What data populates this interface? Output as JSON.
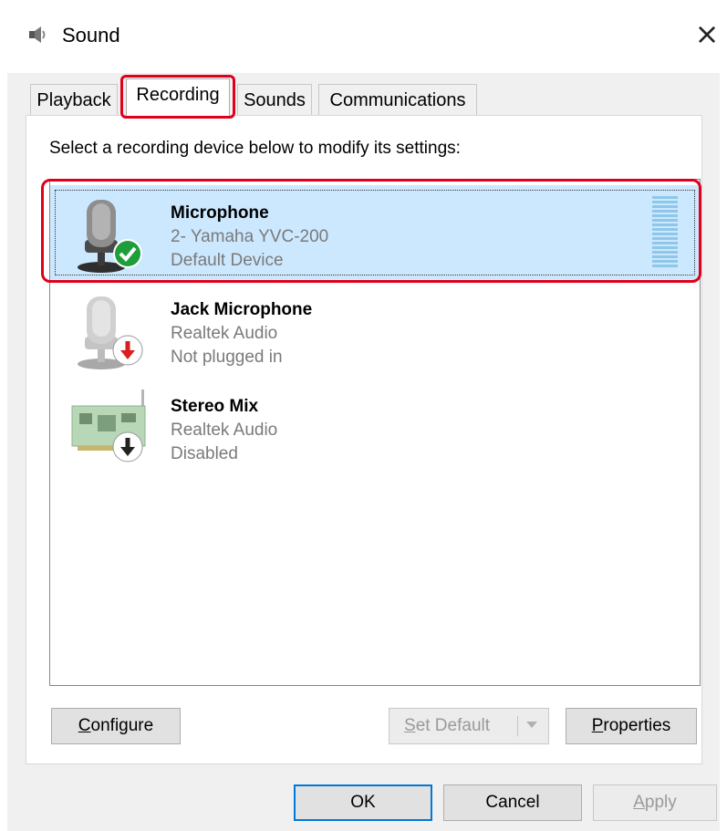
{
  "window": {
    "title": "Sound",
    "close_glyph": "×"
  },
  "tabs": [
    {
      "label": "Playback",
      "active": false
    },
    {
      "label": "Recording",
      "active": true
    },
    {
      "label": "Sounds",
      "active": false
    },
    {
      "label": "Communications",
      "active": false
    }
  ],
  "instruction": "Select a recording device below to modify its settings:",
  "devices": [
    {
      "name": "Microphone",
      "driver": "2- Yamaha YVC-200",
      "status": "Default Device",
      "icon": "microphone-icon",
      "badge": "default-check-icon",
      "selected": true
    },
    {
      "name": "Jack Microphone",
      "driver": "Realtek Audio",
      "status": "Not plugged in",
      "icon": "microphone-icon",
      "badge": "unplugged-arrow-icon",
      "selected": false
    },
    {
      "name": "Stereo Mix",
      "driver": "Realtek Audio",
      "status": "Disabled",
      "icon": "sound-card-icon",
      "badge": "disabled-arrow-icon",
      "selected": false
    }
  ],
  "buttons": {
    "configure": {
      "accel": "C",
      "rest": "onfigure"
    },
    "set_default": {
      "accel": "S",
      "rest": "et Default",
      "enabled": false
    },
    "properties": {
      "accel": "P",
      "rest": "roperties"
    },
    "ok": "OK",
    "cancel": "Cancel",
    "apply": {
      "accel": "A",
      "rest": "pply",
      "enabled": false
    }
  },
  "colors": {
    "selection": "#cce8ff",
    "annotation_highlight": "#e0001b",
    "default_badge": "#1e9e3a",
    "unplugged_badge": "#d81e1e"
  }
}
